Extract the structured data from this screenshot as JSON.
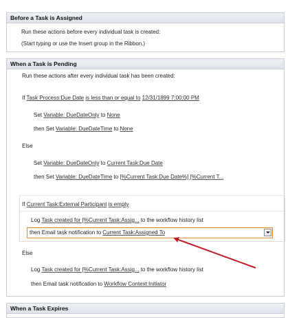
{
  "section1": {
    "title": "Before a Task is Assigned",
    "line1": "Run these actions before every individual task is created:",
    "line2": "(Start typing or use the Insert group in the Ribbon.)"
  },
  "section2": {
    "title": "When a Task is Pending",
    "intro": "Run these actions after every individual task has been created:",
    "if1": {
      "if": "If",
      "field": "Task Process:Due Date",
      "op": "is less than or equal to",
      "value": "12/31/1899 7:00:00 PM"
    },
    "then1a": {
      "set": "Set",
      "var": "Variable: DueDateOnly",
      "to": "to",
      "val": "None"
    },
    "then1b": {
      "then": "then Set",
      "var": "Variable: DueDateTime",
      "to": "to",
      "val": "None"
    },
    "else1": "Else",
    "else1a": {
      "set": "Set",
      "var": "Variable: DueDateOnly",
      "to": "to",
      "val": "Current Task:Due Date"
    },
    "else1b": {
      "then": "then Set",
      "var": "Variable: DueDateTime",
      "to": "to",
      "val": "[%Current Task:Due Date%] [%Current T..."
    },
    "if2": {
      "if": "If",
      "field": "Current Task:External Participant",
      "op": "is empty"
    },
    "log1": {
      "log": "Log",
      "msg": "Task created for [%Current Task:Assig...",
      "rest": "to the workflow history list"
    },
    "email1": {
      "prefix": "then Email task notification to",
      "target": "Current Task:Assigned To"
    },
    "else2": "Else",
    "log2": {
      "log": "Log",
      "msg": "Task created for [%Current Task:Assig...",
      "rest": "to the workflow history list"
    },
    "email2": {
      "prefix": "then Email task notification to",
      "target": "Workflow Context:Initiator"
    }
  },
  "section3": {
    "title": "When a Task Expires"
  },
  "colors": {
    "active_border": "#e58b3a",
    "arrow": "#c0202a",
    "header_bg": "#dde3ea"
  }
}
